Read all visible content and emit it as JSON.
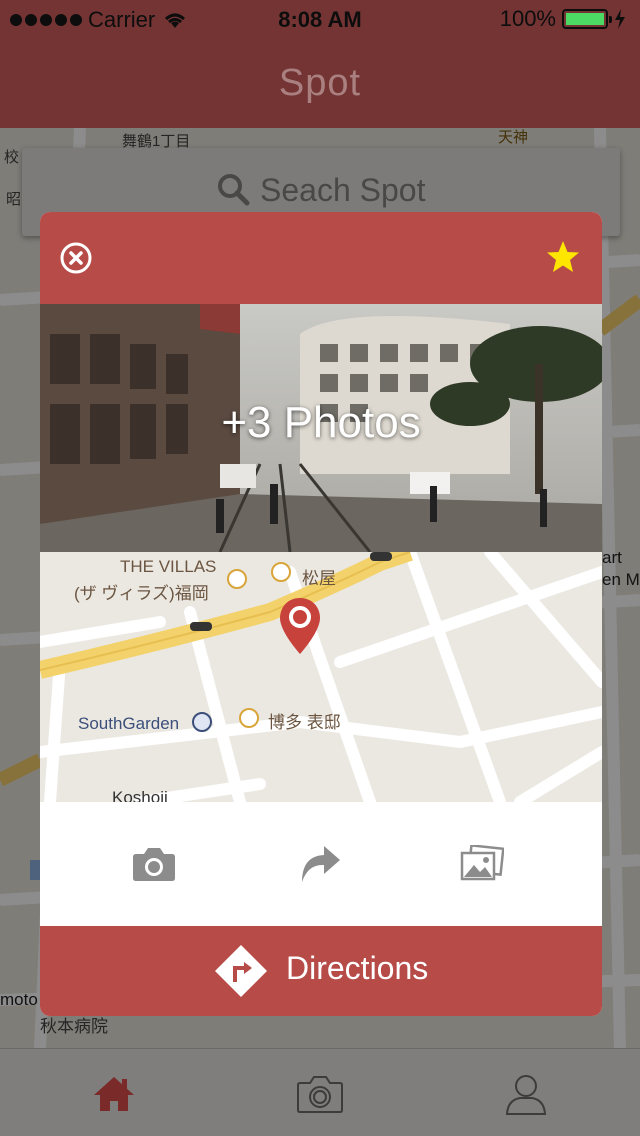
{
  "status_bar": {
    "carrier": "Carrier",
    "time": "8:08 AM",
    "battery": "100%"
  },
  "nav": {
    "title": "Spot"
  },
  "search": {
    "placeholder": "Seach Spot"
  },
  "background_map": {
    "labels": [
      "舞鶴1丁目",
      "天神",
      "校",
      "昭",
      "art",
      "en Ma",
      "moto",
      "秋本病院"
    ]
  },
  "card": {
    "photo_count_label": "+3 Photos",
    "map_labels": {
      "villas_en": "THE VILLAS",
      "villas_jp": "(ザ ヴィラズ)福岡",
      "matsuya": "松屋",
      "southgarden": "SouthGarden",
      "hakata": "博多 表邸",
      "koshoji": "Koshoji"
    },
    "actions": {
      "camera": "camera-icon",
      "share": "share-icon",
      "gallery": "gallery-icon"
    },
    "directions_label": "Directions"
  },
  "tabs": [
    "home",
    "camera",
    "profile"
  ],
  "colors": {
    "brand_red": "#b64b48",
    "nav_dark": "#743434",
    "star": "#ffe600",
    "home_active": "#7a2a28"
  }
}
